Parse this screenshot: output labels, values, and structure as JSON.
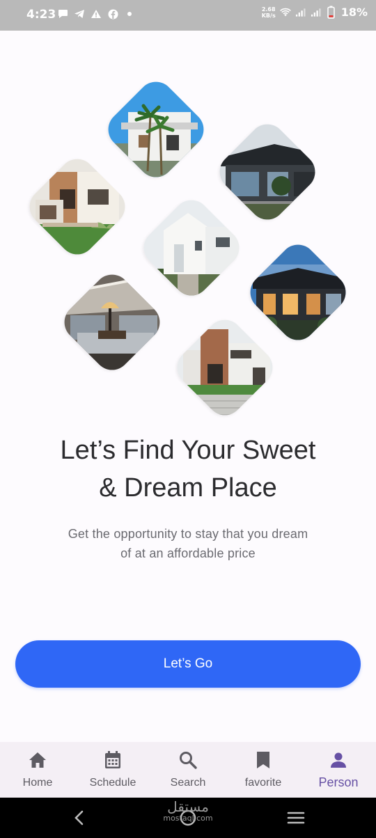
{
  "status_bar": {
    "time": "4:23",
    "net_speed_value": "2.68",
    "net_speed_unit": "KB/s",
    "battery_percent": "18%",
    "left_icons": [
      "chat-bubble-icon",
      "telegram-icon",
      "warning-icon",
      "facebook-icon",
      "dot-icon"
    ],
    "right_icons": [
      "wifi-icon",
      "signal-icon",
      "signal-icon",
      "battery-icon"
    ]
  },
  "collage": {
    "images": [
      "house-with-palm-trees",
      "modern-dark-house",
      "brick-house-with-lawn",
      "white-house-facade",
      "lit-house-at-dusk",
      "patio-lounge",
      "brick-townhouse"
    ]
  },
  "onboarding": {
    "headline_line1": "Let’s Find Your Sweet",
    "headline_line2": "& Dream Place",
    "subtitle_line1": "Get the opportunity to stay that you dream",
    "subtitle_line2": "of at an affordable price",
    "cta_label": "Let’s Go"
  },
  "bottom_nav": {
    "items": [
      {
        "label": "Home",
        "icon": "home-icon"
      },
      {
        "label": "Schedule",
        "icon": "calendar-icon"
      },
      {
        "label": "Search",
        "icon": "search-icon"
      },
      {
        "label": "favorite",
        "icon": "bookmark-icon"
      },
      {
        "label": "Person",
        "icon": "person-icon"
      }
    ],
    "active": "Person"
  },
  "system_nav": {
    "buttons": [
      "back-icon",
      "home-circle-icon",
      "recents-menu-icon"
    ]
  },
  "watermark": {
    "arabic": "مستقل",
    "latin": "mostaql.com"
  },
  "colors": {
    "accent": "#2f67f6",
    "active_nav": "#6650a4",
    "background": "#fdfbfe",
    "nav_background": "#f4eff5"
  }
}
